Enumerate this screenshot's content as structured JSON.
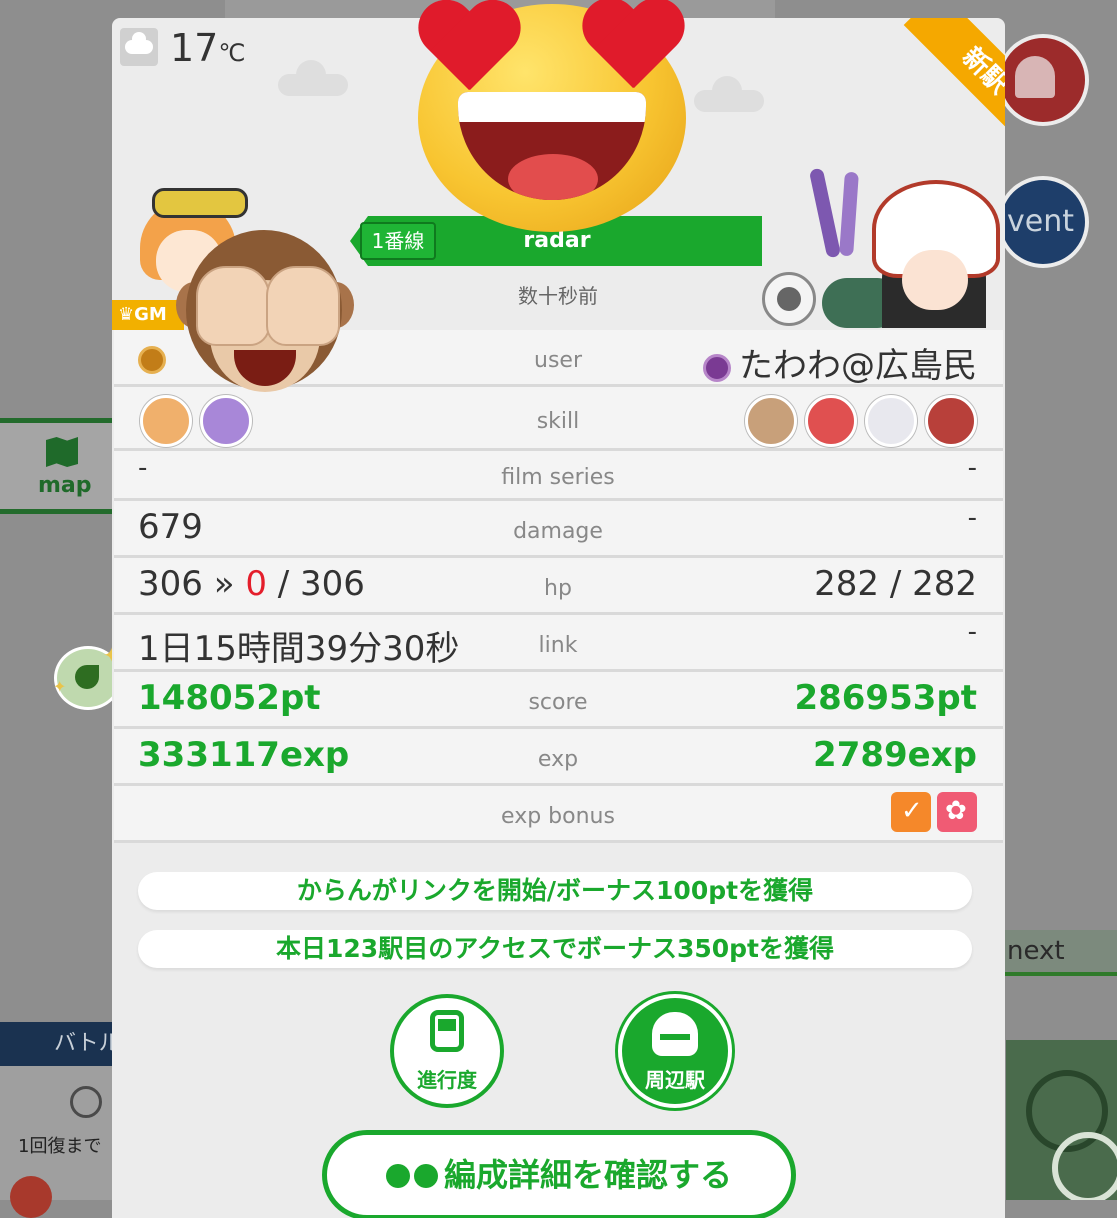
{
  "background": {
    "map_label": "map",
    "event_label": "vent",
    "next_label": "next",
    "battle_label": "バトル",
    "recover_label": "1回復まで"
  },
  "header": {
    "temperature": "17",
    "temperature_unit": "℃",
    "new_station_badge": "新駅",
    "gm_badge": "GM",
    "line_tag": "1番線",
    "line_name": "radar",
    "time_ago": "数十秒前"
  },
  "rows": {
    "user": {
      "label": "user",
      "right": "たわわ@広島民"
    },
    "skill": {
      "label": "skill"
    },
    "film_series": {
      "label": "film series",
      "left": "-",
      "right": "-"
    },
    "damage": {
      "label": "damage",
      "left": "679",
      "right": "-"
    },
    "hp": {
      "label": "hp",
      "left_from": "306 »",
      "left_to": "0",
      "left_max": "/ 306",
      "right": "282 / 282"
    },
    "link": {
      "label": "link",
      "left": "1日15時間39分30秒",
      "right": "-"
    },
    "score": {
      "label": "score",
      "left": "148052pt",
      "right": "286953pt"
    },
    "exp": {
      "label": "exp",
      "left": "333117exp",
      "right": "2789exp"
    },
    "exp_bonus": {
      "label": "exp bonus"
    }
  },
  "messages": [
    "からんがリンクを開始/ボーナス100ptを獲得",
    "本日123駅目のアクセスでボーナス350ptを獲得"
  ],
  "buttons": {
    "progress": "進行度",
    "nearby": "周辺駅",
    "detail": "編成詳細を確認する"
  },
  "colors": {
    "accent_green": "#1aa82d",
    "damage_red": "#e41e2b",
    "badge_orange": "#f5a800"
  },
  "icons": [
    "weather-cloud-icon",
    "bell-icon",
    "map-icon",
    "eye-icon",
    "train-icon",
    "station-icon",
    "heart-eyes-emoji",
    "see-no-evil-monkey-emoji"
  ]
}
